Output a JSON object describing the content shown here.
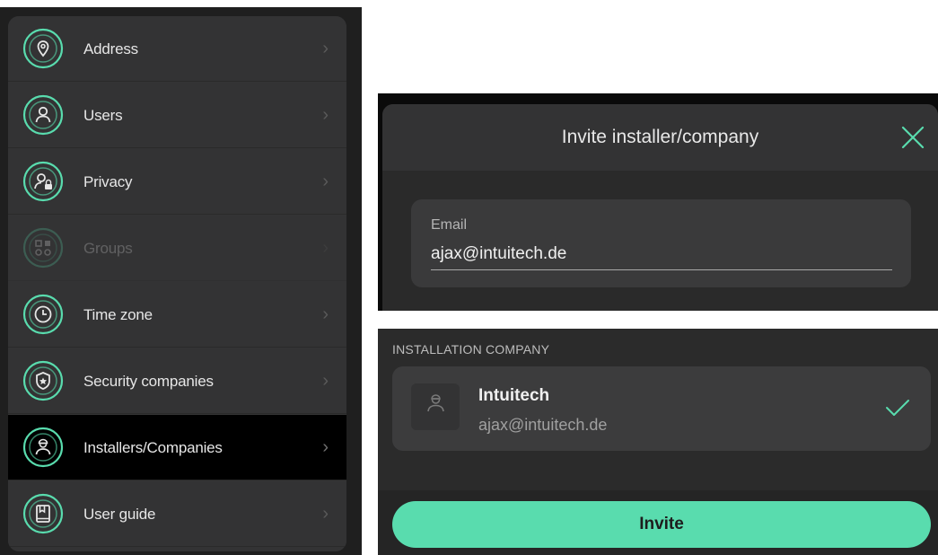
{
  "menu": {
    "items": [
      {
        "label": "Address",
        "icon": "location-pin-icon"
      },
      {
        "label": "Users",
        "icon": "user-icon"
      },
      {
        "label": "Privacy",
        "icon": "user-lock-icon"
      },
      {
        "label": "Groups",
        "icon": "groups-grid-icon",
        "disabled": true
      },
      {
        "label": "Time zone",
        "icon": "clock-icon"
      },
      {
        "label": "Security companies",
        "icon": "shield-icon"
      },
      {
        "label": "Installers/Companies",
        "icon": "installer-icon",
        "active": true
      },
      {
        "label": "User guide",
        "icon": "book-icon"
      }
    ],
    "chevron": "›"
  },
  "dialog": {
    "title": "Invite installer/company",
    "email_label": "Email",
    "email_value": "ajax@intuitech.de"
  },
  "company": {
    "section_label": "INSTALLATION COMPANY",
    "name": "Intuitech",
    "email": "ajax@intuitech.de",
    "invite_label": "Invite"
  },
  "colors": {
    "accent": "#59dcae",
    "panel": "#333334",
    "active_row": "#000000"
  }
}
